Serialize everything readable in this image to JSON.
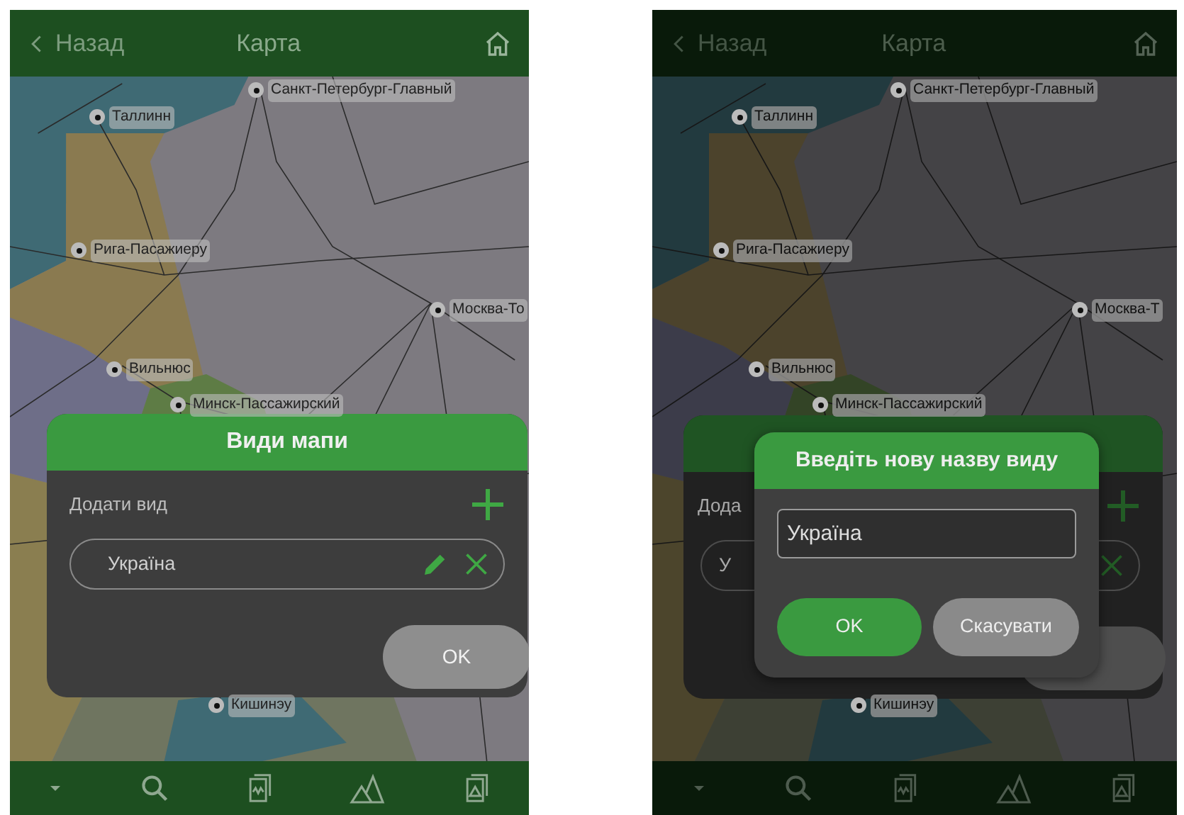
{
  "screens": [
    {
      "top_bar": {
        "back": "Назад",
        "title": "Карта"
      },
      "map_labels": [
        "Санкт-Петербург-Главный",
        "Таллинн",
        "Рига-Пасажиеру",
        "Москва-То",
        "Вильнюс",
        "Минск-Пассажирский",
        "Кишинэу"
      ],
      "dialog": {
        "title": "Види мапи",
        "add_label": "Додати вид",
        "items": [
          "Україна"
        ],
        "ok": "OK"
      }
    },
    {
      "top_bar": {
        "back": "Назад",
        "title": "Карта"
      },
      "map_labels": [
        "Санкт-Петербург-Главный",
        "Таллинн",
        "Рига-Пасажиеру",
        "Москва-Т",
        "Вильнюс",
        "Минск-Пассажирский",
        "Кишинэу"
      ],
      "dialog": {
        "add_label": "Дода",
        "items": [
          "У"
        ]
      },
      "prompt": {
        "title": "Введіть нову назву виду",
        "value": "Україна",
        "ok": "OK",
        "cancel": "Скасувати"
      }
    }
  ]
}
